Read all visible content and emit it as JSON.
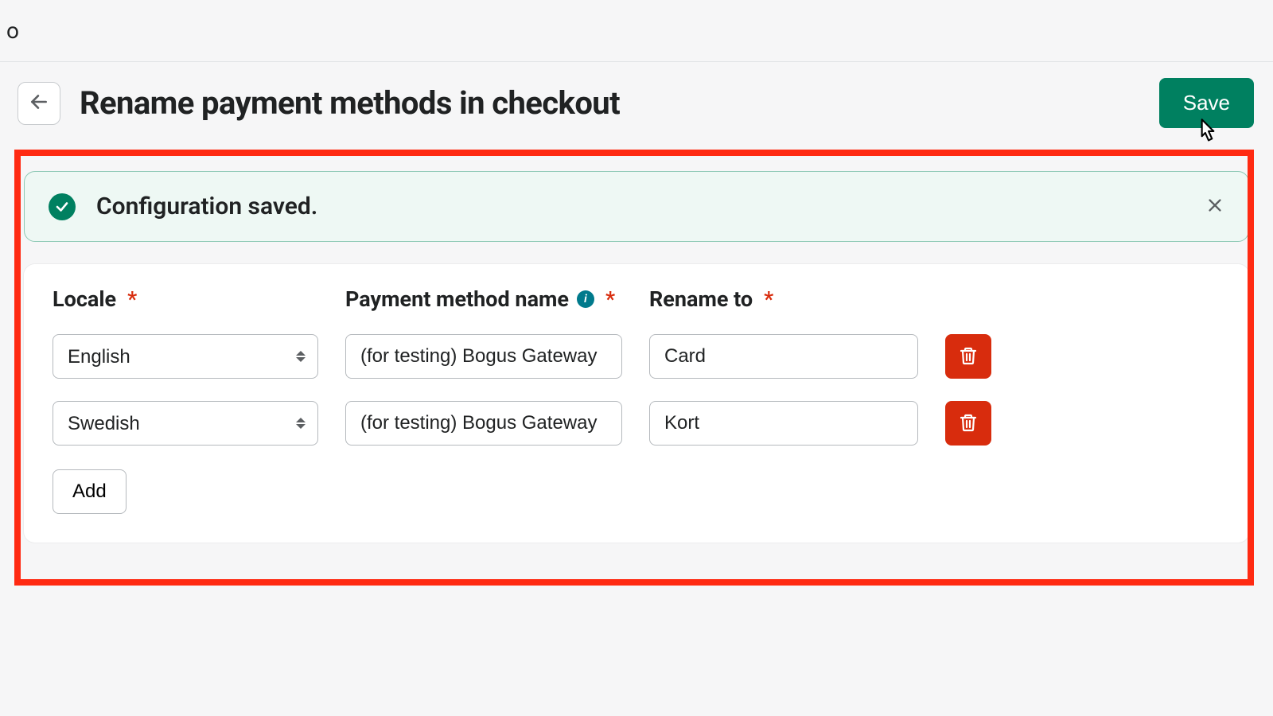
{
  "topstrip": {
    "fragment": "o"
  },
  "header": {
    "title": "Rename payment methods in checkout",
    "save_label": "Save"
  },
  "banner": {
    "message": "Configuration saved."
  },
  "table": {
    "headers": {
      "locale": "Locale",
      "method": "Payment method name",
      "rename": "Rename to"
    },
    "rows": [
      {
        "locale": "English",
        "method": "(for testing) Bogus Gateway",
        "rename": "Card"
      },
      {
        "locale": "Swedish",
        "method": "(for testing) Bogus Gateway",
        "rename": "Kort"
      }
    ],
    "add_label": "Add"
  }
}
